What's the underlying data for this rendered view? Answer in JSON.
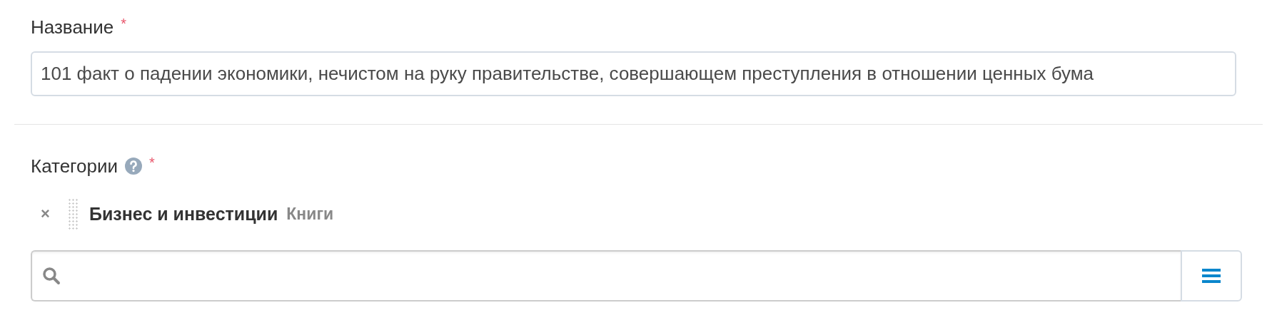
{
  "title_field": {
    "label": "Название",
    "required_mark": "*",
    "value": "101 факт о падении экономики, нечистом на руку правительстве, совершающем преступления в отношении ценных бума"
  },
  "categories": {
    "label": "Категории",
    "help": true,
    "required_mark": "*",
    "items": [
      {
        "remove": "×",
        "name": "Бизнес и инвестиции",
        "parent": "Книги"
      }
    ]
  }
}
